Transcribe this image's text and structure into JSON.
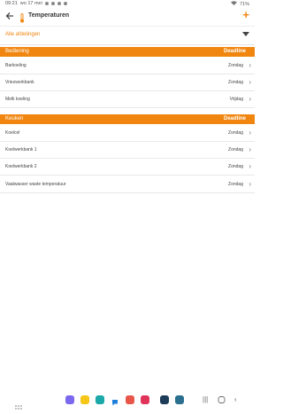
{
  "status": {
    "time": "09:21",
    "date": "wo 17 mei",
    "battery": "71%"
  },
  "appbar": {
    "title": "Temperaturen",
    "back_icon": "arrow-left-icon",
    "title_icon": "thermometer-icon",
    "add_icon": "plus-icon",
    "add_label": "+"
  },
  "filter": {
    "selected": "Alle afdelingen"
  },
  "sections": [
    {
      "name": "Bediening",
      "deadline_label": "Deadline",
      "rows": [
        {
          "name": "Barkoeling",
          "deadline": "Zondag"
        },
        {
          "name": "Vriezwerkbank",
          "deadline": "Zondag"
        },
        {
          "name": "Melk koeling",
          "deadline": "Vrijdag"
        }
      ]
    },
    {
      "name": "Keuken",
      "deadline_label": "Deadline",
      "rows": [
        {
          "name": "Koelcel",
          "deadline": "Zondag"
        },
        {
          "name": "Koelwerkbank 1",
          "deadline": "Zondag"
        },
        {
          "name": "Koelwerkbank 2",
          "deadline": "Zondag"
        },
        {
          "name": "Vaatwasser waste temperatuur",
          "deadline": "Zondag"
        }
      ]
    }
  ],
  "colors": {
    "accent": "#f0860f"
  },
  "navbar": {
    "apps": [
      "app-icon-1",
      "app-icon-2",
      "app-icon-3",
      "chat-app-icon",
      "app-icon-5",
      "app-icon-6",
      "app-icon-7",
      "app-icon-8"
    ]
  }
}
